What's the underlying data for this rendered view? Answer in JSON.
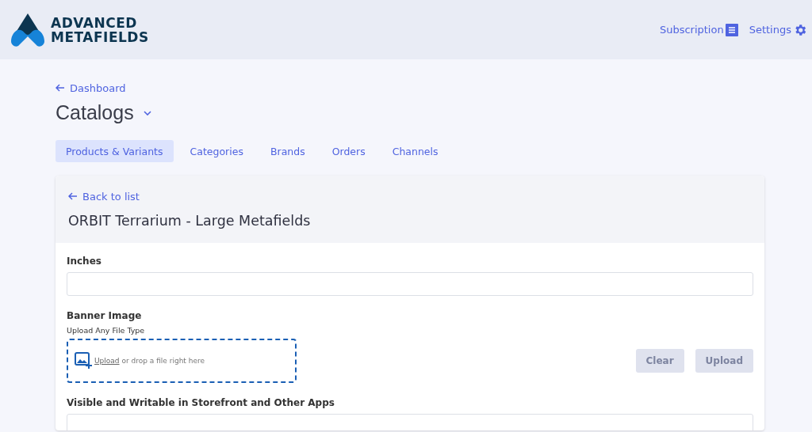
{
  "header": {
    "logo": {
      "line_1": "ADVANCED",
      "line_2": "METAFIELDS"
    },
    "nav": [
      {
        "label": "Subscription",
        "kind": "list"
      },
      {
        "label": "Settings",
        "kind": "gear"
      }
    ]
  },
  "back_link": "Dashboard",
  "page_title": "Catalogs",
  "tabs": [
    {
      "label": "Products & Variants",
      "selected": true
    },
    {
      "label": "Categories",
      "selected": false
    },
    {
      "label": "Brands",
      "selected": false
    },
    {
      "label": "Orders",
      "selected": false
    },
    {
      "label": "Channels",
      "selected": false
    }
  ],
  "card": {
    "back_link": "Back to list",
    "title": "ORBIT Terrarium - Large Metafields",
    "fields": [
      {
        "kind": "text",
        "label": "Inches"
      },
      {
        "kind": "file",
        "label": "Banner Image",
        "hint": "Upload Any File Type",
        "link": "Upload",
        "drop_text": "or drop a file right here",
        "buttons": [
          {
            "label": "Clear",
            "disabled": true
          },
          {
            "label": "Upload",
            "disabled": true
          }
        ]
      },
      {
        "kind": "text",
        "label": "Visible and Writable in Storefront and Other Apps"
      }
    ]
  }
}
